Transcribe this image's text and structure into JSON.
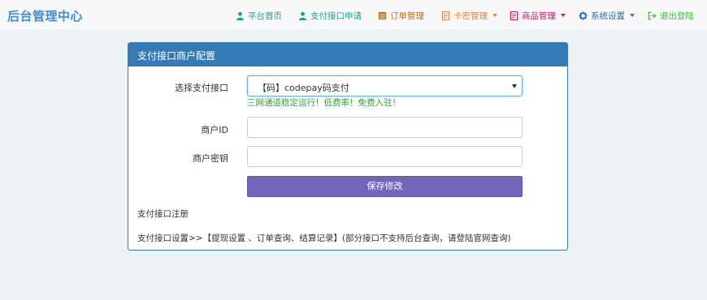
{
  "app": {
    "title": "后台管理中心"
  },
  "nav": {
    "items": [
      {
        "label": "平台首页",
        "icon": "user-icon",
        "color": "#1d9e96"
      },
      {
        "label": "支付接口申请",
        "icon": "user-icon",
        "color": "#1d9e96"
      },
      {
        "label": "订单管理",
        "icon": "list-icon",
        "color": "#c46d17"
      },
      {
        "label": "卡密管理",
        "icon": "book-icon",
        "color": "#e8833a"
      },
      {
        "label": "商品管理",
        "icon": "book-icon",
        "color": "#d6166e"
      },
      {
        "label": "系统设置",
        "icon": "gear-icon",
        "color": "#2e6fb0"
      },
      {
        "label": "退出登陆",
        "icon": "logout-icon",
        "color": "#3fbf3f"
      }
    ]
  },
  "panel": {
    "title": "支付接口商户配置",
    "fields": {
      "gateway_label": "选择支付接口",
      "gateway_value": "【码】codepay码支付",
      "gateway_hint": "三网通道稳定运行！低费率！免费入驻！",
      "merchant_id_label": "商户ID",
      "merchant_id_value": "",
      "merchant_key_label": "商户密钥",
      "merchant_key_value": ""
    },
    "save_label": "保存修改",
    "register_text": "支付接口注册",
    "settings_text": "支付接口设置>>【提现设置 、订单查询、结算记录】(部分接口不支持后台查询，请登陆官网查询)"
  },
  "colors": {
    "brand": "#3f8fd0",
    "panel_header": "#337ab7",
    "save_button": "#7266ba",
    "hint": "#3c9a3c"
  }
}
